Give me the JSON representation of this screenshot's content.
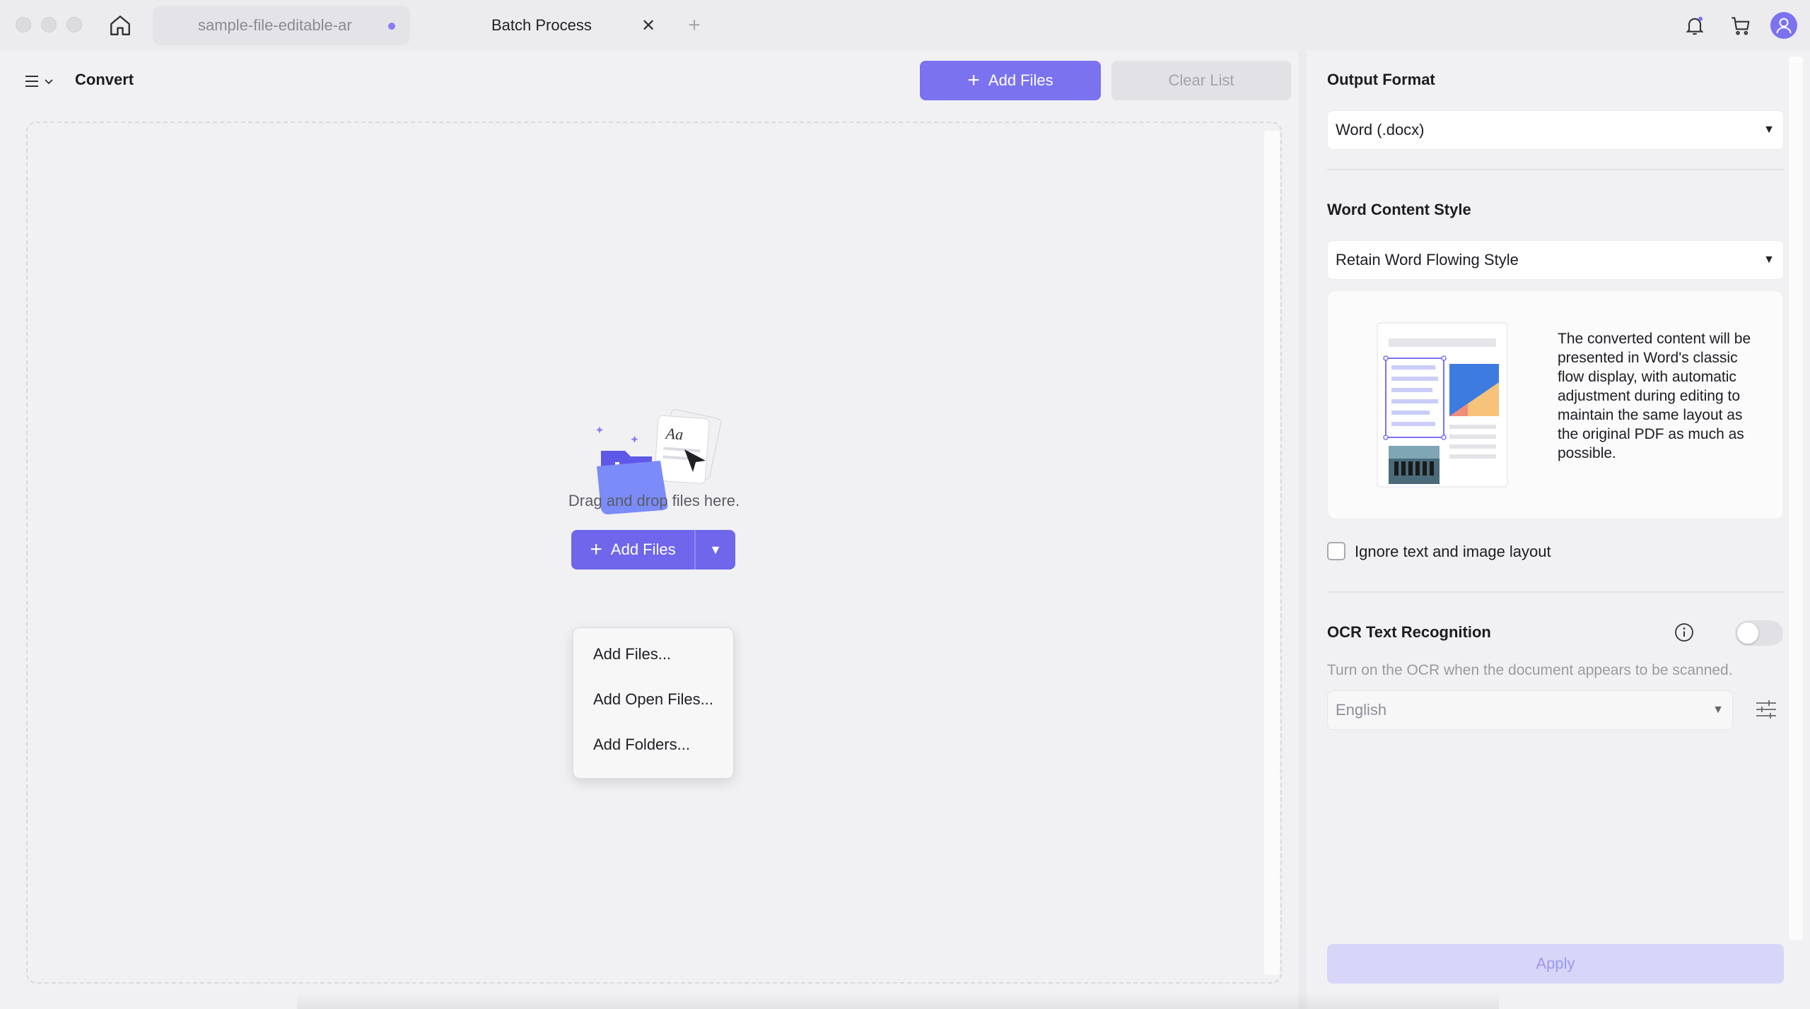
{
  "tabs": [
    {
      "label": "sample-file-editable-ar",
      "modified": true
    },
    {
      "label": "Batch Process"
    }
  ],
  "toolbar": {
    "title": "Convert",
    "add_files_label": "Add Files",
    "clear_list_label": "Clear List"
  },
  "dropzone": {
    "hint": "Drag and drop files here.",
    "add_files_label": "Add Files",
    "menu": [
      "Add Files...",
      "Add Open Files...",
      "Add Folders..."
    ]
  },
  "settings": {
    "output_format_label": "Output Format",
    "output_format_value": "Word (.docx)",
    "content_style_label": "Word Content Style",
    "content_style_value": "Retain Word Flowing Style",
    "content_style_description": "The converted content will be presented in Word's classic flow display, with automatic adjustment during editing to maintain the same layout as the original PDF as much as possible.",
    "ignore_layout_label": "Ignore text and image layout",
    "ignore_layout_checked": false,
    "ocr_label": "OCR Text Recognition",
    "ocr_enabled": false,
    "ocr_hint": "Turn on the OCR when the document appears to be scanned.",
    "ocr_language": "English",
    "apply_label": "Apply"
  },
  "colors": {
    "accent": "#7b72f0",
    "background": "#f1f1f3"
  }
}
